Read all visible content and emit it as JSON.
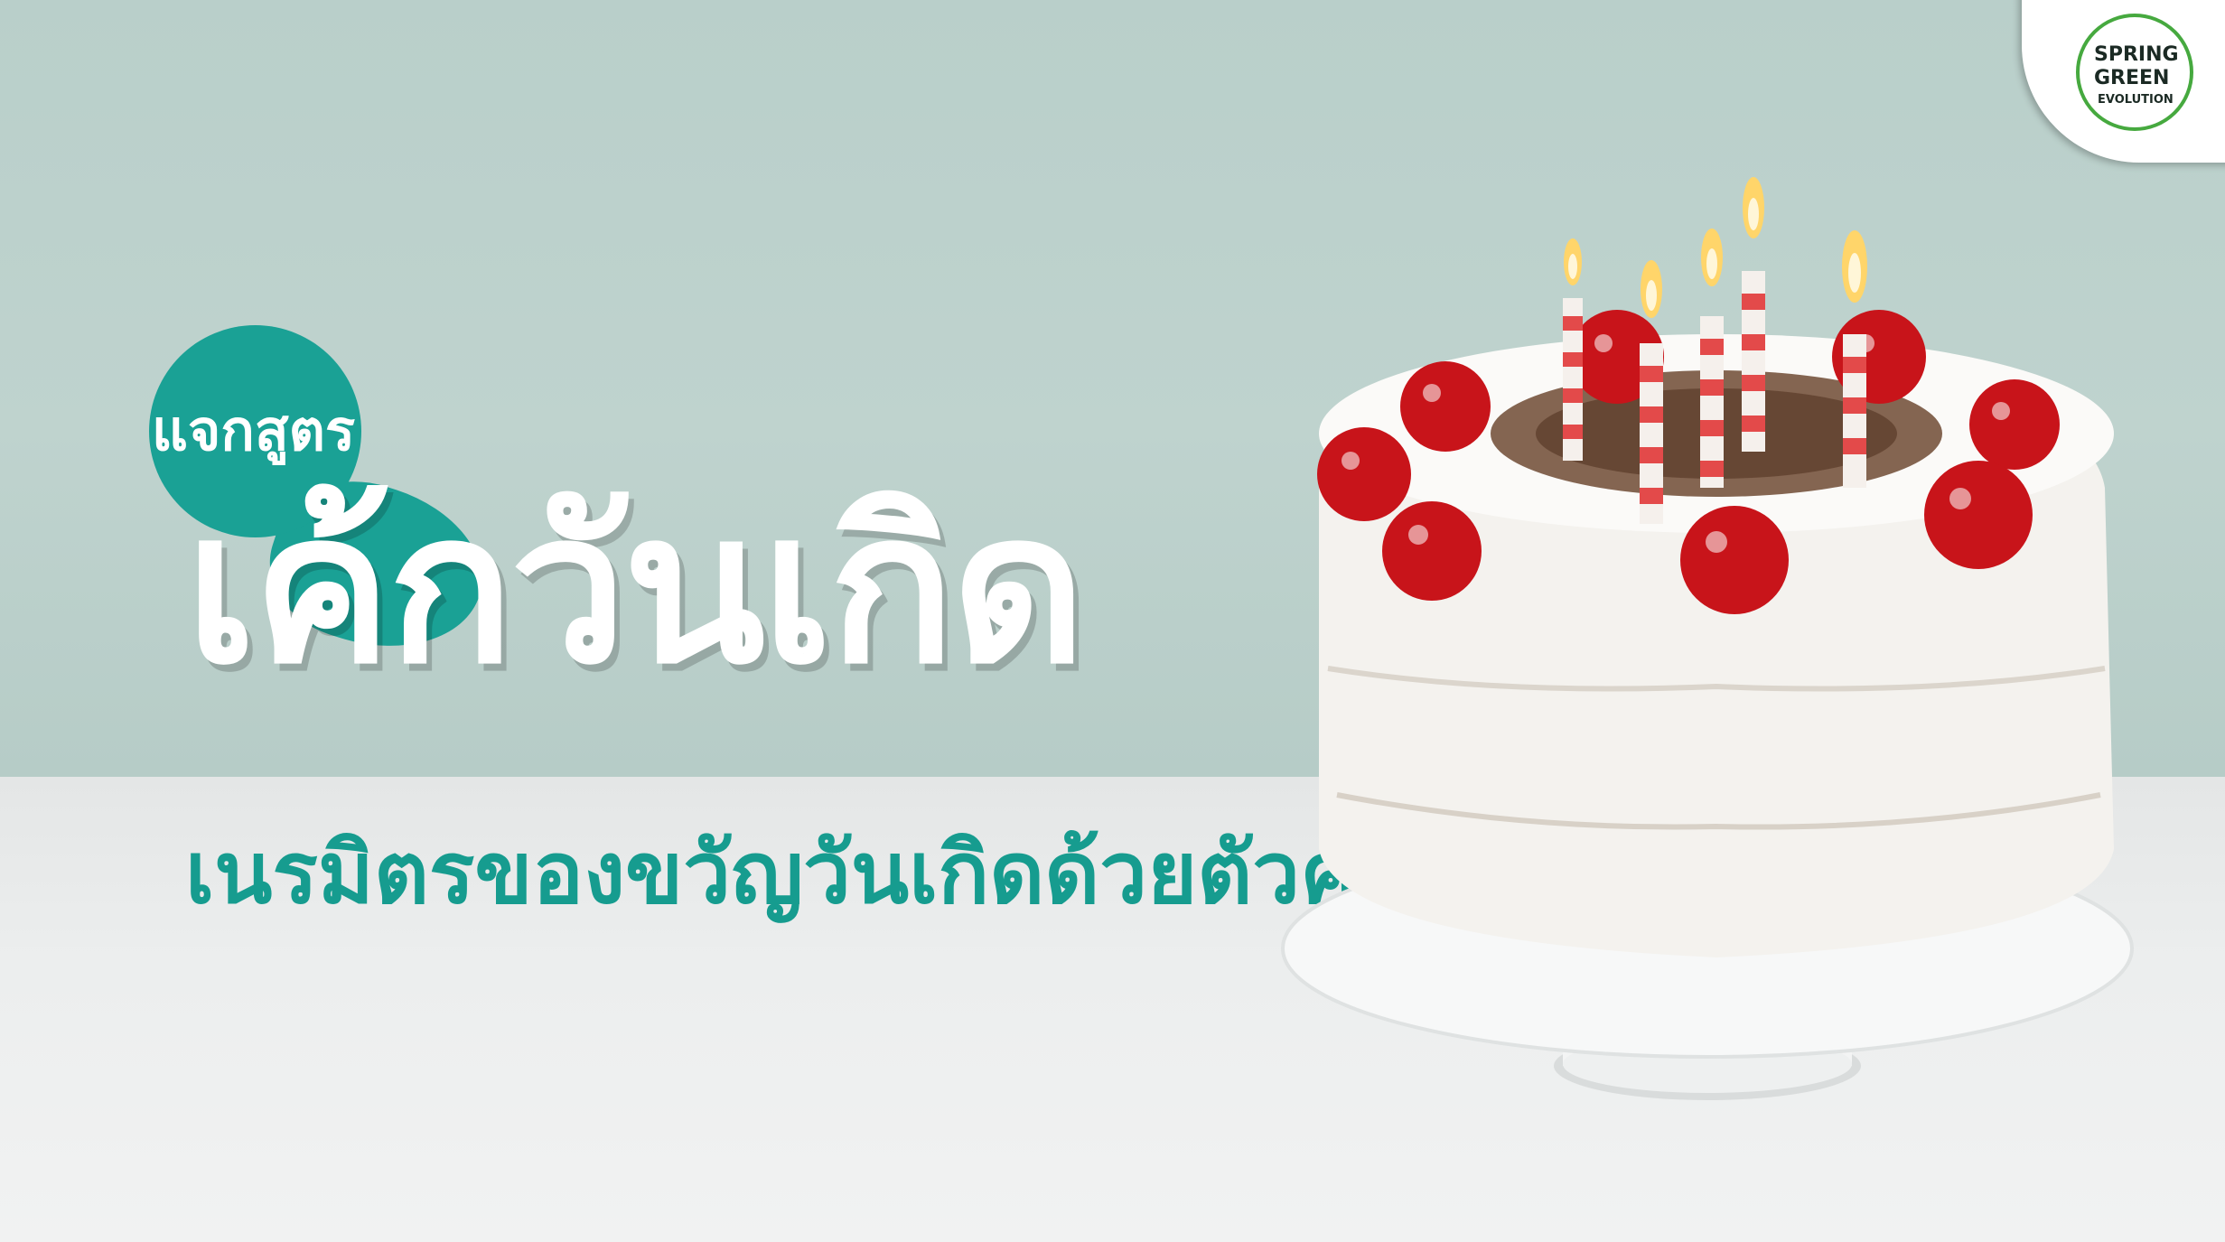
{
  "tag": {
    "text": "แจกสูตร"
  },
  "headline": {
    "text": "เค้กวันเกิด"
  },
  "subtitle": {
    "text": "เนรมิตรของขวัญวันเกิดด้วยตัวคุณเอง"
  },
  "logo": {
    "line1": "SPRING",
    "line2": "GREEN",
    "line3": "EVOLUTION"
  },
  "colors": {
    "accent": "#1aa195",
    "subtitle": "#169c8f",
    "wall": "#bfd3ce",
    "table": "#eceeee",
    "logo_green": "#46a93f"
  },
  "icons": {
    "cake": "birthday-cake-icon",
    "logo": "spring-green-evolution-logo"
  }
}
